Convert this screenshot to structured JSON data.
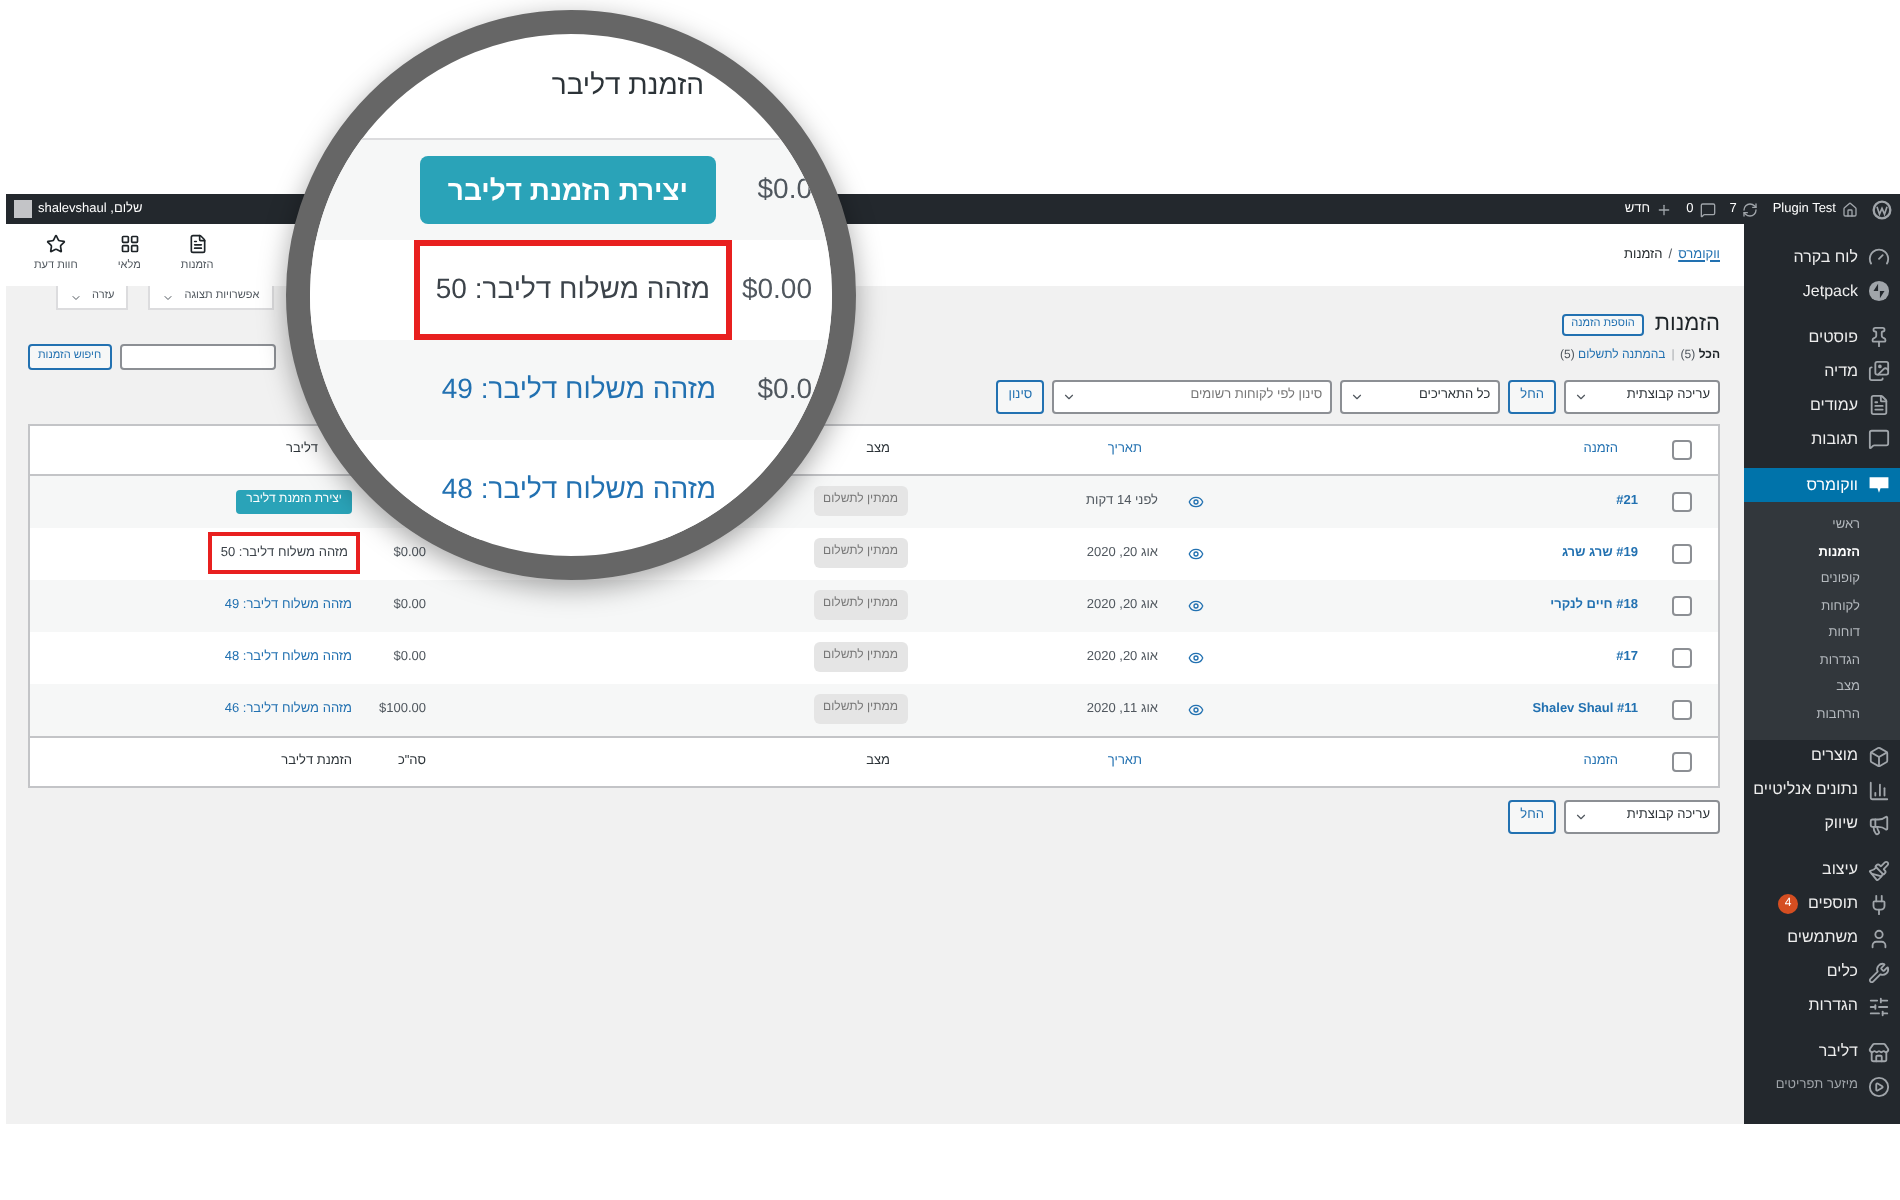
{
  "admin_bar": {
    "site": "Plugin Test",
    "updates": "7",
    "comments": "0",
    "new": "חדש",
    "greeting": "שלום, shalevshaul"
  },
  "sidebar": {
    "groups": [
      [
        {
          "label": "לוח בקרה",
          "kind": "item",
          "selected": false
        },
        {
          "label": "Jetpack",
          "kind": "item",
          "selected": false
        }
      ],
      [
        {
          "label": "פוסטים",
          "kind": "item",
          "selected": false
        },
        {
          "label": "מדיה",
          "kind": "item",
          "selected": false
        },
        {
          "label": "עמודים",
          "kind": "item",
          "selected": false
        },
        {
          "label": "תגובות",
          "kind": "item",
          "selected": false
        }
      ],
      [
        {
          "label": "ווקומרס",
          "kind": "item",
          "selected": true,
          "children": [
            {
              "label": "ראשי",
              "selected": false
            },
            {
              "label": "הזמנות",
              "selected": true
            },
            {
              "label": "קופונים",
              "selected": false
            },
            {
              "label": "לקוחות",
              "selected": false
            },
            {
              "label": "דוחות",
              "selected": false
            },
            {
              "label": "הגדרות",
              "selected": false
            },
            {
              "label": "מצב",
              "selected": false
            },
            {
              "label": "הרחבות",
              "selected": false
            }
          ]
        },
        {
          "label": "מוצרים",
          "kind": "item",
          "selected": false
        },
        {
          "label": "נתונים אנליטיים",
          "kind": "item",
          "selected": false
        },
        {
          "label": "שיווק",
          "kind": "item",
          "selected": false
        }
      ],
      [
        {
          "label": "עיצוב",
          "kind": "item",
          "selected": false
        },
        {
          "label": "תוספים",
          "kind": "item",
          "selected": false,
          "badge": "4"
        },
        {
          "label": "משתמשים",
          "kind": "item",
          "selected": false
        },
        {
          "label": "כלים",
          "kind": "item",
          "selected": false
        },
        {
          "label": "הגדרות",
          "kind": "item",
          "selected": false
        }
      ],
      [
        {
          "label": "דליבר",
          "kind": "item",
          "selected": false
        },
        {
          "label": "מיזער תפריטים",
          "kind": "collapse",
          "selected": false
        }
      ]
    ]
  },
  "header": {
    "breadcrumb": [
      {
        "label": "ווקומרס",
        "kind": "link"
      },
      {
        "label": "הזמנות",
        "kind": "text"
      }
    ],
    "separator": "/",
    "activity": [
      {
        "label": "הזמנות"
      },
      {
        "label": "מלאי"
      },
      {
        "label": "חוות דעת"
      }
    ]
  },
  "screen_tabs": [
    "אפשרויות תצוגה",
    "עזרה"
  ],
  "title": "הזמנות",
  "add_button": "הוספת הזמנה",
  "views": [
    {
      "label": "הכל",
      "count": "(5)",
      "selected": true
    },
    {
      "label": "בהמתנה לתשלום",
      "count": "(5)",
      "selected": false
    }
  ],
  "views_separator": "|",
  "search": {
    "button": "חיפוש הזמנות"
  },
  "filters": {
    "bulk": "עריכה קבוצתית",
    "apply": "החל",
    "dates": "כל התאריכים",
    "customer_placeholder": "סינון לפי לקוחות רשומים",
    "filter": "סינון"
  },
  "table": {
    "header": {
      "checked": false,
      "order": "הזמנה",
      "date": "תאריך",
      "status": "מצב",
      "driver": "דליבר"
    },
    "rows": [
      {
        "checked": false,
        "order": "#21",
        "date": "לפני 14 דקות",
        "status": "ממתין לתשלום",
        "driver": {
          "kind": "button",
          "label": "יצירת הזמנת דליבר"
        },
        "highlighted": false
      },
      {
        "checked": false,
        "order": "#19 שרג שרג",
        "date": "אוג 20, 2020",
        "status": "ממתין לתשלום",
        "total": "$0.00",
        "driver": {
          "kind": "text",
          "label": "מזהה משלוח דליבר: 50"
        },
        "highlighted": true
      },
      {
        "checked": false,
        "order": "#18 חיים לנקרי",
        "date": "אוג 20, 2020",
        "status": "ממתין לתשלום",
        "total": "$0.00",
        "driver": {
          "kind": "link",
          "label": "מזהה משלוח דליבר: 49"
        },
        "highlighted": false
      },
      {
        "checked": false,
        "order": "#17",
        "date": "אוג 20, 2020",
        "status": "ממתין לתשלום",
        "total": "$0.00",
        "driver": {
          "kind": "link",
          "label": "מזהה משלוח דליבר: 48"
        },
        "highlighted": false
      },
      {
        "checked": false,
        "order": "#11 Shalev Shaul",
        "date": "אוג 11, 2020",
        "status": "ממתין לתשלום",
        "total": "$100.00",
        "driver": {
          "kind": "link",
          "label": "מזהה משלוח דליבר: 46"
        },
        "highlighted": false
      }
    ],
    "footer": {
      "checked": false,
      "order": "הזמנה",
      "date": "תאריך",
      "status": "מצב",
      "total": "סה\"כ",
      "driver": "הזמנת דליבר"
    }
  },
  "bottom_bulk": {
    "bulk": "עריכה קבוצתית",
    "apply": "החל"
  },
  "magnifier": {
    "header": "הזמנת דליבר",
    "rows": [
      {
        "total": "$0.0",
        "driver": {
          "kind": "button",
          "label": "יצירת הזמנת דליבר"
        },
        "highlighted": false
      },
      {
        "total": "$0.00",
        "driver": {
          "kind": "text",
          "label": "מזהה משלוח דליבר: 50"
        },
        "highlighted": true
      },
      {
        "total": "$0.0",
        "driver": {
          "kind": "link",
          "label": "מזהה משלוח דליבר: 49"
        },
        "highlighted": false
      },
      {
        "driver": {
          "kind": "link",
          "label": "מזהה משלוח דליבר: 48"
        },
        "highlighted": false
      }
    ]
  }
}
